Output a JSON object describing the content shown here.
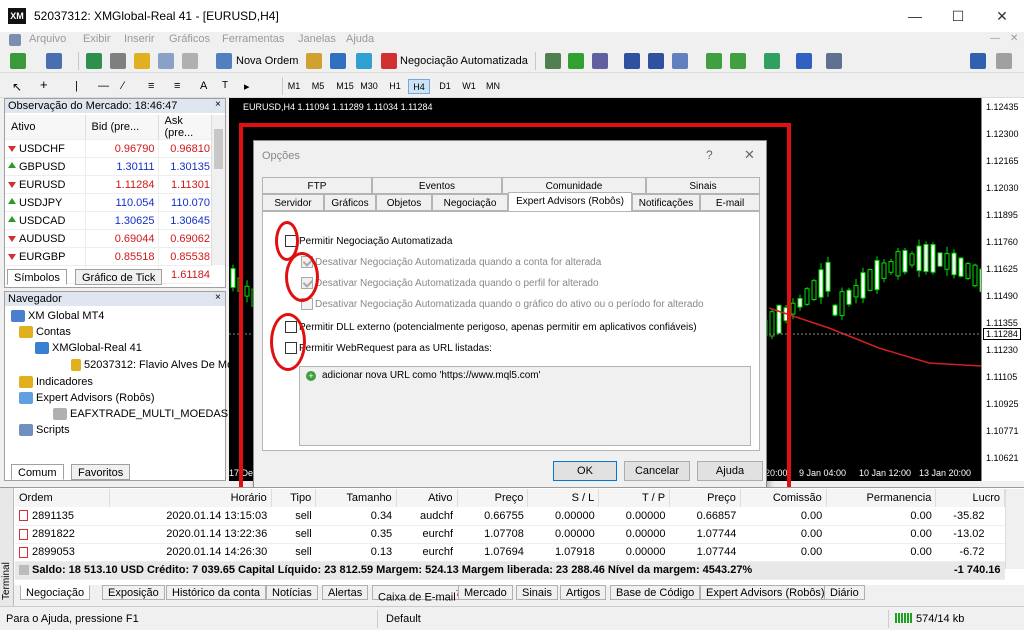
{
  "window": {
    "title": "52037312: XMGlobal-Real 41 - [EURUSD,H4]",
    "app_logo": "XM"
  },
  "menu": [
    "Arquivo",
    "Exibir",
    "Inserir",
    "Gráficos",
    "Ferramentas",
    "Janelas",
    "Ajuda"
  ],
  "toolbar": {
    "new_order": "Nova Ordem",
    "auto_trading": "Negociação Automatizada",
    "timeframes": [
      "M1",
      "M5",
      "M15",
      "M30",
      "H1",
      "H4",
      "D1",
      "W1",
      "MN"
    ],
    "selected_timeframe": "H4"
  },
  "market_watch": {
    "title": "Observação do Mercado: 18:46:47",
    "headers": [
      "Ativo",
      "Bid (pre...",
      "Ask (pre..."
    ],
    "rows": [
      {
        "symbol": "USDCHF",
        "bid": "0.96790",
        "ask": "0.96810",
        "dir": "down"
      },
      {
        "symbol": "GBPUSD",
        "bid": "1.30111",
        "ask": "1.30135",
        "dir": "up"
      },
      {
        "symbol": "EURUSD",
        "bid": "1.11284",
        "ask": "1.11301",
        "dir": "down"
      },
      {
        "symbol": "USDJPY",
        "bid": "110.054",
        "ask": "110.070",
        "dir": "up"
      },
      {
        "symbol": "USDCAD",
        "bid": "1.30625",
        "ask": "1.30645",
        "dir": "up"
      },
      {
        "symbol": "AUDUSD",
        "bid": "0.69044",
        "ask": "0.69062",
        "dir": "down"
      },
      {
        "symbol": "EURGBP",
        "bid": "0.85518",
        "ask": "0.85538",
        "dir": "down"
      },
      {
        "symbol": "EURAUD",
        "bid": "1.61158",
        "ask": "1.61184",
        "dir": "down"
      }
    ],
    "tabs": [
      "Símbolos",
      "Gráfico de Tick"
    ]
  },
  "navigator": {
    "title": "Navegador",
    "items": [
      "XM Global MT4",
      "Contas",
      "XMGlobal-Real 41",
      "52037312: Flavio Alves De Mo",
      "Indicadores",
      "Expert Advisors (Robôs)",
      "EAFXTRADE_MULTI_MOEDAS",
      "Scripts"
    ],
    "tabs": [
      "Comum",
      "Favoritos"
    ]
  },
  "chart": {
    "header": "EURUSD,H4  1.11094 1.11289 1.11034 1.11284",
    "price_ticks": [
      "1.12435",
      "1.12300",
      "1.12165",
      "1.12030",
      "1.11895",
      "1.11760",
      "1.11625",
      "1.11490",
      "1.11355",
      "1.11230",
      "1.11105",
      "1.10925",
      "1.10771",
      "1.10621"
    ],
    "current_price": "1.11284",
    "time_ticks": [
      "17 Dec",
      "20:00",
      "9 Jan 04:00",
      "10 Jan 12:00",
      "13 Jan 20:00"
    ]
  },
  "dialog": {
    "title": "Opções",
    "help_glyph": "?",
    "tabs_row1": [
      "FTP",
      "Eventos",
      "Comunidade",
      "Sinais"
    ],
    "tabs_row2": [
      "Servidor",
      "Gráficos",
      "Objetos",
      "Negociação",
      "Expert Advisors (Robôs)",
      "Notificações",
      "E-mail"
    ],
    "options": [
      {
        "label": "Permitir Negociação Automatizada",
        "checked": false,
        "disabled": false
      },
      {
        "label": "Desativar Negociação Automatizada quando a conta for alterada",
        "checked": true,
        "disabled": true
      },
      {
        "label": "Desativar Negociação Automatizada quando o perfil for alterado",
        "checked": true,
        "disabled": true
      },
      {
        "label": "Desativar Negociação Automatizada quando o gráfico do ativo ou o período for alterado",
        "checked": false,
        "disabled": true
      },
      {
        "label": "Permitir DLL externo (potencialmente perigoso, apenas permitir em aplicativos confiáveis)",
        "checked": false,
        "disabled": false
      },
      {
        "label": "Permitir WebRequest para as URL listadas:",
        "checked": false,
        "disabled": false
      }
    ],
    "url_item": "adicionar nova URL como 'https://www.mql5.com'",
    "buttons": [
      "OK",
      "Cancelar",
      "Ajuda"
    ]
  },
  "terminal": {
    "headers": [
      "Ordem",
      "Horário",
      "Tipo",
      "Tamanho",
      "Ativo",
      "Preço",
      "S / L",
      "T / P",
      "Preço",
      "Comissão",
      "Permanencia",
      "Lucro"
    ],
    "rows": [
      [
        "2891135",
        "2020.01.14 13:15:03",
        "sell",
        "0.34",
        "audchf",
        "0.66755",
        "0.00000",
        "0.00000",
        "0.66857",
        "0.00",
        "0.00",
        "-35.82"
      ],
      [
        "2891822",
        "2020.01.14 13:22:36",
        "sell",
        "0.35",
        "eurchf",
        "1.07708",
        "0.00000",
        "0.00000",
        "1.07744",
        "0.00",
        "0.00",
        "-13.02"
      ],
      [
        "2899053",
        "2020.01.14 14:26:30",
        "sell",
        "0.13",
        "eurchf",
        "1.07694",
        "1.07918",
        "0.00000",
        "1.07744",
        "0.00",
        "0.00",
        "-6.72"
      ]
    ],
    "summary": "Saldo: 18 513.10 USD  Crédito: 7 039.65  Capital Líquido: 23 812.59  Margem: 524.13  Margem liberada: 23 288.46  Nível da margem: 4543.27%",
    "summary_total": "-1 740.16",
    "side_label": "Terminal",
    "tabs": [
      "Negociação",
      "Exposição",
      "Histórico da conta",
      "Notícias",
      "Alertas",
      "Caixa de E-mail",
      "Mercado",
      "Sinais",
      "Artigos",
      "Base de Código",
      "Expert Advisors (Robôs)",
      "Diário"
    ],
    "mail_badge": "7"
  },
  "status": {
    "help": "Para o Ajuda, pressione F1",
    "profile": "Default",
    "traffic": "574/14 kb"
  }
}
